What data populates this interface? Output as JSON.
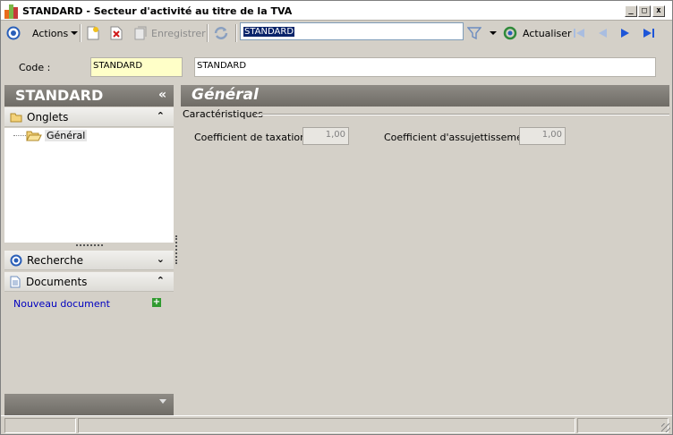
{
  "window": {
    "title": "STANDARD -  Secteur d'activité au titre de la TVA",
    "buttons": {
      "minimize": "_",
      "maximize": "□",
      "close": "x"
    }
  },
  "toolbar": {
    "actions_label": "Actions",
    "save_label": "Enregistrer",
    "search_value": "STANDARD",
    "refresh_label": "Actualiser",
    "icons": [
      "nav-circle-icon",
      "new-document-icon",
      "delete-icon",
      "save-icon",
      "sync-icon",
      "filter-icon",
      "refresh-icon",
      "first-icon",
      "previous-icon",
      "next-icon",
      "last-icon"
    ]
  },
  "code": {
    "label": "Code :",
    "value": "STANDARD",
    "description": "STANDARD"
  },
  "sidebar": {
    "title": "STANDARD",
    "collapse": "«",
    "onglets": {
      "label": "Onglets",
      "chevron": "⌃"
    },
    "tree": [
      {
        "label": "Général"
      }
    ],
    "recherche": {
      "label": "Recherche",
      "chevron": "⌄"
    },
    "documents": {
      "label": "Documents",
      "chevron": "⌃"
    },
    "new_document": "Nouveau document"
  },
  "main": {
    "title": "Général",
    "group": "Caractéristiques",
    "fields": [
      {
        "label": "Coefficient de taxation :",
        "value": "1,00"
      },
      {
        "label": "Coefficient d'assujettissement :",
        "value": "1,00"
      }
    ]
  },
  "colors": {
    "header_gray": "#7e7b75",
    "code_highlight": "#ffffc8",
    "link_blue": "#0000c0",
    "selection_blue": "#0a246a"
  }
}
